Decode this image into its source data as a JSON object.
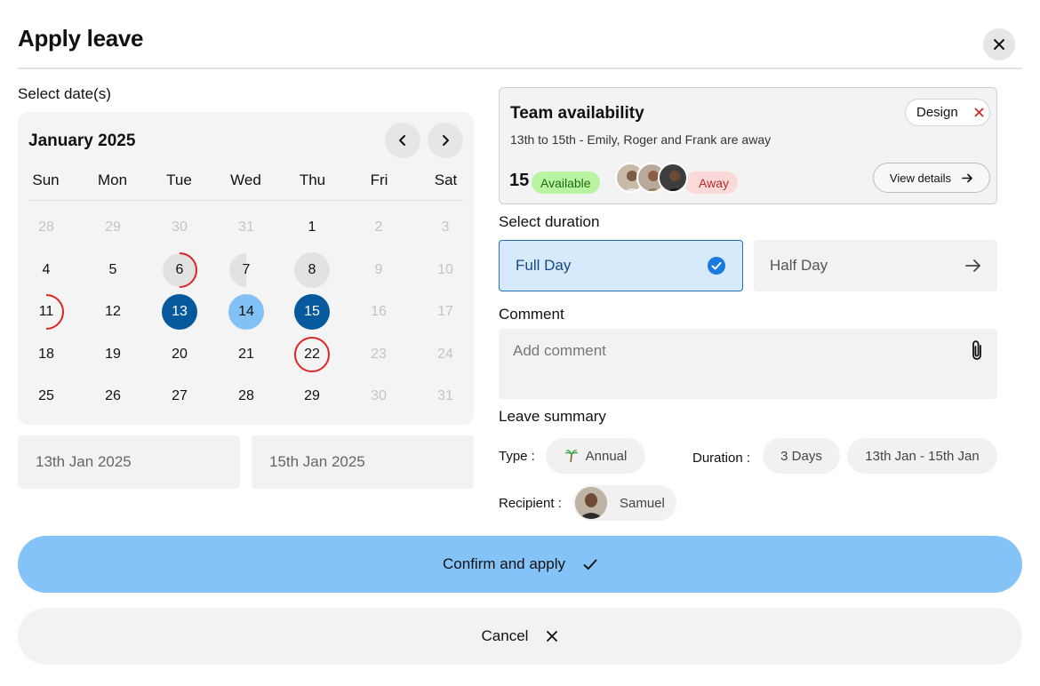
{
  "header": {
    "title": "Apply leave"
  },
  "dates_section": {
    "label": "Select date(s)"
  },
  "calendar": {
    "month": "January 2025",
    "weekdays": [
      "Sun",
      "Mon",
      "Tue",
      "Wed",
      "Thu",
      "Fri",
      "Sat"
    ],
    "rows": [
      [
        "28",
        "29",
        "30",
        "31",
        "1",
        "2",
        "3"
      ],
      [
        "4",
        "5",
        "6",
        "7",
        "8",
        "9",
        "10"
      ],
      [
        "11",
        "12",
        "13",
        "14",
        "15",
        "16",
        "17"
      ],
      [
        "18",
        "19",
        "20",
        "21",
        "22",
        "23",
        "24"
      ],
      [
        "25",
        "26",
        "27",
        "28",
        "29",
        "30",
        "31"
      ]
    ],
    "start_date": "13th Jan 2025",
    "end_date": "15th Jan 2025"
  },
  "team": {
    "title": "Team availability",
    "subtitle": "13th to 15th - Emily, Roger and Frank are away",
    "filter_chip": "Design",
    "available_count": "15",
    "available_label": "Available",
    "away_label": "Away",
    "view_details": "View details"
  },
  "duration": {
    "label": "Select duration",
    "full_day": "Full Day",
    "half_day": "Half Day"
  },
  "comment": {
    "label": "Comment",
    "placeholder": "Add comment"
  },
  "summary": {
    "label": "Leave summary",
    "type_label": "Type :",
    "type_value": "Annual",
    "duration_label": "Duration :",
    "duration_days": "3 Days",
    "duration_range": "13th Jan - 15th Jan",
    "recipient_label": "Recipient :",
    "recipient_name": "Samuel"
  },
  "actions": {
    "confirm": "Confirm and apply",
    "cancel": "Cancel"
  },
  "colors": {
    "selected": "#06599c",
    "in_range": "#82c1f6",
    "confirm_bg": "#84c3f8",
    "away_ring": "#dc2626",
    "available_badge": "#b9f5a0",
    "away_badge": "#fcd9d9"
  }
}
